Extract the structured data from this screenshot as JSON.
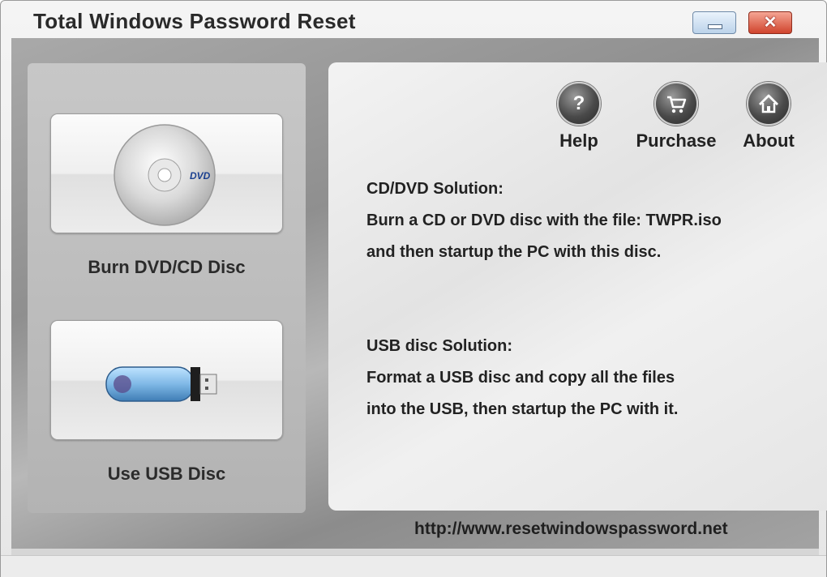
{
  "window": {
    "title": "Total Windows Password Reset",
    "minimize_icon": "minimize-icon",
    "close_icon": "close-icon",
    "close_glyph": "✕"
  },
  "left_panel": {
    "dvd_button": {
      "label": "Burn DVD/CD Disc",
      "icon": "dvd-disc-icon",
      "disc_text": "DVD"
    },
    "usb_button": {
      "label": "Use USB Disc",
      "icon": "usb-drive-icon"
    }
  },
  "toolbar": {
    "help": {
      "label": "Help",
      "icon": "question-icon",
      "glyph": "?"
    },
    "purchase": {
      "label": "Purchase",
      "icon": "shopping-cart-icon"
    },
    "about": {
      "label": "About",
      "icon": "home-icon"
    }
  },
  "info": {
    "cd_title": "CD/DVD Solution:",
    "cd_line1": "Burn a CD or DVD disc with the file: TWPR.iso",
    "cd_line2": "and then startup the PC with this disc.",
    "usb_title": "USB disc Solution:",
    "usb_line1": "Format a USB disc and copy all the files",
    "usb_line2": "into the USB, then startup the PC with it."
  },
  "footer": {
    "url": "http://www.resetwindowspassword.net"
  }
}
